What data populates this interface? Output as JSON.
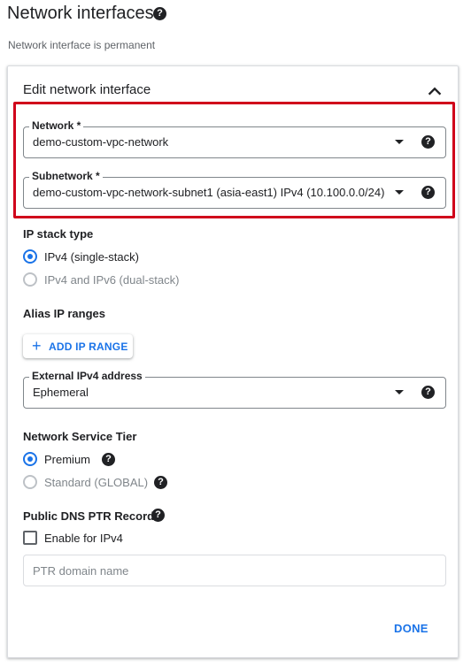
{
  "header": {
    "title": "Network interfaces",
    "subtitle": "Network interface is permanent",
    "help_icon": "help-icon"
  },
  "section": {
    "title": "Edit network interface",
    "collapse_icon": "chevron-up-icon"
  },
  "fields": {
    "network": {
      "label": "Network *",
      "value": "demo-custom-vpc-network"
    },
    "subnetwork": {
      "label": "Subnetwork *",
      "value": "demo-custom-vpc-network-subnet1 (asia-east1) IPv4 (10.100.0.0/24)"
    },
    "external_ip": {
      "label": "External IPv4 address",
      "value": "Ephemeral"
    }
  },
  "ip_stack": {
    "label": "IP stack type",
    "options": [
      {
        "label": "IPv4 (single-stack)",
        "selected": true
      },
      {
        "label": "IPv4 and IPv6 (dual-stack)",
        "selected": false
      }
    ]
  },
  "alias": {
    "label": "Alias IP ranges",
    "add_button": "ADD IP RANGE"
  },
  "tier": {
    "label": "Network Service Tier",
    "options": [
      {
        "label": "Premium",
        "selected": true
      },
      {
        "label": "Standard (GLOBAL)",
        "selected": false
      }
    ]
  },
  "dns": {
    "label": "Public DNS PTR Record",
    "checkbox_label": "Enable for IPv4",
    "checked": false,
    "ptr_placeholder": "PTR domain name",
    "ptr_value": ""
  },
  "actions": {
    "done": "DONE"
  },
  "colors": {
    "accent": "#1a73e8",
    "highlight": "#d0021b"
  }
}
